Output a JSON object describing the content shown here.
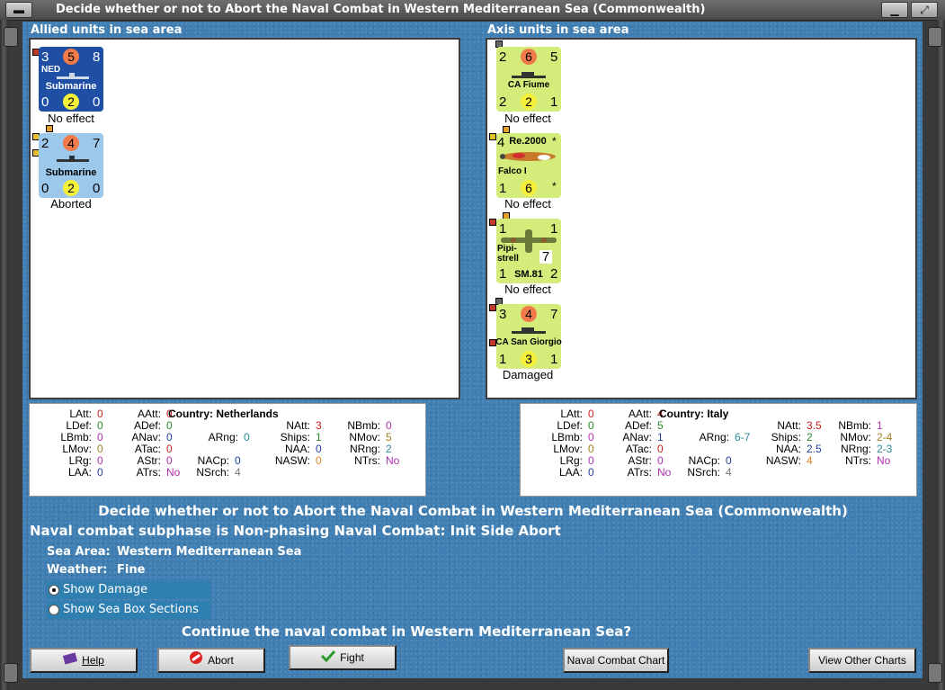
{
  "window": {
    "title": "Decide whether or not to Abort the Naval Combat in Western Mediterranean Sea (Commonwealth)"
  },
  "allied": {
    "label": "Allied units in sea area",
    "units": [
      {
        "top_left": "3",
        "top_mid": "5",
        "top_right": "8",
        "nation": "NED",
        "name": "Submarine",
        "bot_left": "0",
        "bot_mid": "2",
        "bot_right": "0",
        "status": "No effect",
        "color": "#1f4fa5"
      },
      {
        "top_left": "2",
        "top_mid": "4",
        "top_right": "7",
        "nation": "",
        "name": "Submarine",
        "bot_left": "0",
        "bot_mid": "2",
        "bot_right": "0",
        "status": "Aborted",
        "color": "#9cc8ec"
      }
    ]
  },
  "axis": {
    "label": "Axis units in sea area",
    "units": [
      {
        "top_left": "2",
        "top_mid": "6",
        "top_right": "5",
        "name": "CA Fiume",
        "bot_left": "2",
        "bot_mid": "2",
        "bot_right": "1",
        "status": "No effect"
      },
      {
        "top_left": "4",
        "type": "Re.2000",
        "star": "*",
        "name": "Falco I",
        "bot_left": "1",
        "bot_mid": "6",
        "bot_right": "*",
        "status": "No effect"
      },
      {
        "top_left": "1",
        "top_right": "1",
        "name1": "Pipi-",
        "name2": "strell",
        "mid_right": "7",
        "type": "SM.81",
        "bot_left": "1",
        "bot_right": "2",
        "status": "No effect"
      },
      {
        "top_left": "3",
        "top_mid": "4",
        "top_right": "7",
        "name": "CA San Giorgio",
        "bot_left": "1",
        "bot_mid": "3",
        "bot_right": "1",
        "status": "Damaged"
      }
    ]
  },
  "allied_stats": {
    "country_label": "Country: Netherlands",
    "LAtt": "0",
    "LDef": "0",
    "LBmb": "0",
    "LMov": "0",
    "LRg": "0",
    "LAA": "0",
    "AAtt": "0",
    "ADef": "0",
    "ANav": "0",
    "ATac": "0",
    "AStr": "0",
    "ATrs": "No",
    "ARng": "0",
    "NACp": "0",
    "NAtt": "3",
    "Ships": "1",
    "NAA": "0",
    "NASW": "0",
    "NSrch": "4",
    "NBmb": "0",
    "NMov": "5",
    "NRng": "2",
    "NTrs": "No"
  },
  "axis_stats": {
    "country_label": "Country: Italy",
    "LAtt": "0",
    "LDef": "0",
    "LBmb": "0",
    "LMov": "0",
    "LRg": "0",
    "LAA": "0",
    "AAtt": "4",
    "ADef": "5",
    "ANav": "1",
    "ATac": "0",
    "AStr": "0",
    "ATrs": "No",
    "ARng": "6-7",
    "NACp": "0",
    "NAtt": "3.5",
    "Ships": "2",
    "NAA": "2.5",
    "NASW": "4",
    "NSrch": "4",
    "NBmb": "1",
    "NMov": "2-4",
    "NRng": "2-3",
    "NTrs": "No"
  },
  "info": {
    "headline": "Decide whether or not to Abort the Naval Combat in Western Mediterranean Sea (Commonwealth)",
    "subphase": "Naval combat subphase is Non-phasing Naval Combat: Init Side Abort",
    "sea_area_label": "Sea Area:",
    "sea_area_value": "Western Mediterranean Sea",
    "weather_label": "Weather:",
    "weather_value": "Fine",
    "show_damage": "Show Damage",
    "show_sea_box": "Show Sea Box Sections",
    "question": "Continue the naval combat in Western Mediterranean Sea?"
  },
  "buttons": {
    "help": "Help",
    "abort": "Abort",
    "fight": "Fight",
    "naval_chart": "Naval Combat Chart",
    "other_charts": "View Other Charts"
  },
  "colors": {
    "background": "#3f7fb3",
    "axis_counter": "#d4ed7a",
    "red_value": "#cc2222",
    "green_value": "#2a8a2a"
  }
}
